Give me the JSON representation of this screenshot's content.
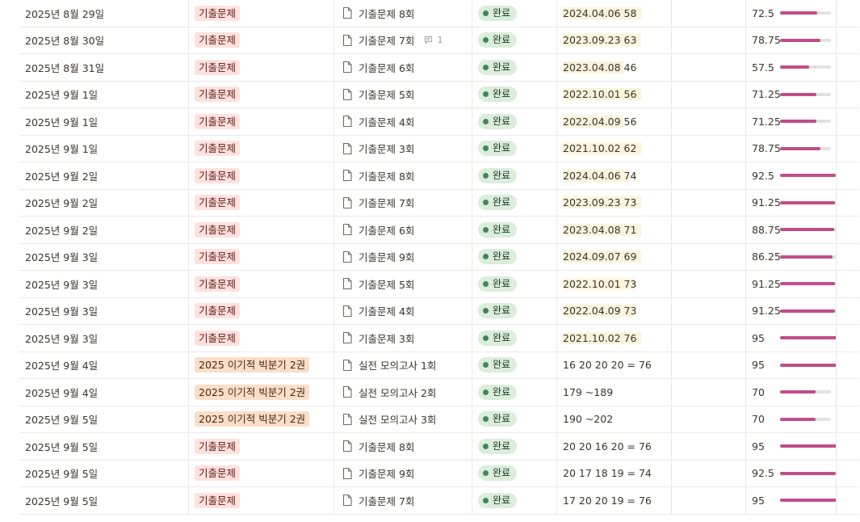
{
  "colors": {
    "tag_exam_bg": "#ffe2dd",
    "tag_exam_fg": "#5d1715",
    "tag_book_bg": "#fadec9",
    "tag_book_fg": "#49290e",
    "status_bg": "#dbeddb",
    "status_dot": "#448361",
    "highlight": "#fbf3db",
    "bar_fill": "#c14c8a",
    "bar_track": "#e3e2e0"
  },
  "rows": [
    {
      "date": "2025년 8월 29일",
      "tag": "기출문제",
      "tag_type": "exam",
      "name": "기출문제 8회",
      "comment_count": "",
      "status": "완료",
      "note": "2024.04.06 58",
      "highlight_chars": 13,
      "score": "72.5",
      "score_ratio": 0.725
    },
    {
      "date": "2025년 8월 30일",
      "tag": "기출문제",
      "tag_type": "exam",
      "name": "기출문제 7회",
      "comment_count": "1",
      "status": "완료",
      "note": "2023.09.23 63",
      "highlight_chars": 13,
      "score": "78.75",
      "score_ratio": 0.7875
    },
    {
      "date": "2025년 8월 31일",
      "tag": "기출문제",
      "tag_type": "exam",
      "name": "기출문제 6회",
      "comment_count": "",
      "status": "완료",
      "note": "2023.04.08 46",
      "highlight_chars": 10,
      "score": "57.5",
      "score_ratio": 0.575
    },
    {
      "date": "2025년 9월 1일",
      "tag": "기출문제",
      "tag_type": "exam",
      "name": "기출문제 5회",
      "comment_count": "",
      "status": "완료",
      "note": "2022.10.01 56",
      "highlight_chars": 13,
      "score": "71.25",
      "score_ratio": 0.7125
    },
    {
      "date": "2025년 9월 1일",
      "tag": "기출문제",
      "tag_type": "exam",
      "name": "기출문제 4회",
      "comment_count": "",
      "status": "완료",
      "note": "2022.04.09 56",
      "highlight_chars": 10,
      "score": "71.25",
      "score_ratio": 0.7125
    },
    {
      "date": "2025년 9월 1일",
      "tag": "기출문제",
      "tag_type": "exam",
      "name": "기출문제 3회",
      "comment_count": "",
      "status": "완료",
      "note": "2021.10.02 62",
      "highlight_chars": 13,
      "score": "78.75",
      "score_ratio": 0.7875
    },
    {
      "date": "2025년 9월 2일",
      "tag": "기출문제",
      "tag_type": "exam",
      "name": "기출문제 8회",
      "comment_count": "",
      "status": "완료",
      "note": "2024.04.06 74",
      "highlight_chars": 11,
      "score": "92.5",
      "score_ratio": 0.925
    },
    {
      "date": "2025년 9월 2일",
      "tag": "기출문제",
      "tag_type": "exam",
      "name": "기출문제 7회",
      "comment_count": "",
      "status": "완료",
      "note": "2023.09.23 73",
      "highlight_chars": 13,
      "score": "91.25",
      "score_ratio": 0.9125
    },
    {
      "date": "2025년 9월 2일",
      "tag": "기출문제",
      "tag_type": "exam",
      "name": "기출문제 6회",
      "comment_count": "",
      "status": "완료",
      "note": "2023.04.08 71",
      "highlight_chars": 13,
      "score": "88.75",
      "score_ratio": 0.8875
    },
    {
      "date": "2025년 9월 3일",
      "tag": "기출문제",
      "tag_type": "exam",
      "name": "기출문제 9회",
      "comment_count": "",
      "status": "완료",
      "note": "2024.09.07 69",
      "highlight_chars": 13,
      "score": "86.25",
      "score_ratio": 0.8625
    },
    {
      "date": "2025년 9월 3일",
      "tag": "기출문제",
      "tag_type": "exam",
      "name": "기출문제 5회",
      "comment_count": "",
      "status": "완료",
      "note": "2022.10.01 73",
      "highlight_chars": 12,
      "score": "91.25",
      "score_ratio": 0.9125
    },
    {
      "date": "2025년 9월 3일",
      "tag": "기출문제",
      "tag_type": "exam",
      "name": "기출문제 4회",
      "comment_count": "",
      "status": "완료",
      "note": "2022.04.09 73",
      "highlight_chars": 12,
      "score": "91.25",
      "score_ratio": 0.9125
    },
    {
      "date": "2025년 9월 3일",
      "tag": "기출문제",
      "tag_type": "exam",
      "name": "기출문제 3회",
      "comment_count": "",
      "status": "완료",
      "note": "2021.10.02 76",
      "highlight_chars": 13,
      "score": "95",
      "score_ratio": 0.95
    },
    {
      "date": "2025년 9월 4일",
      "tag": "2025 이기적 빅분기 2권",
      "tag_type": "book",
      "name": "실전 모의고사 1회",
      "comment_count": "",
      "status": "완료",
      "note": "16 20 20 20 = 76",
      "highlight_chars": 0,
      "score": "95",
      "score_ratio": 0.95
    },
    {
      "date": "2025년 9월 4일",
      "tag": "2025 이기적 빅분기 2권",
      "tag_type": "book",
      "name": "실전 모의고사 2회",
      "comment_count": "",
      "status": "완료",
      "note": "179 ~189",
      "highlight_chars": 0,
      "score": "70",
      "score_ratio": 0.7
    },
    {
      "date": "2025년 9월 5일",
      "tag": "2025 이기적 빅분기 2권",
      "tag_type": "book",
      "name": "실전 모의고사 3회",
      "comment_count": "",
      "status": "완료",
      "note": "190 ~202",
      "highlight_chars": 0,
      "score": "70",
      "score_ratio": 0.7
    },
    {
      "date": "2025년 9월 5일",
      "tag": "기출문제",
      "tag_type": "exam",
      "name": "기출문제 8회",
      "comment_count": "",
      "status": "완료",
      "note": "20 20 16 20 = 76",
      "highlight_chars": 0,
      "score": "95",
      "score_ratio": 0.95
    },
    {
      "date": "2025년 9월 5일",
      "tag": "기출문제",
      "tag_type": "exam",
      "name": "기출문제 9회",
      "comment_count": "",
      "status": "완료",
      "note": "20 17 18 19 = 74",
      "highlight_chars": 0,
      "score": "92.5",
      "score_ratio": 0.925
    },
    {
      "date": "2025년 9월 5일",
      "tag": "기출문제",
      "tag_type": "exam",
      "name": "기출문제 7회",
      "comment_count": "",
      "status": "완료",
      "note": "17 20 20 19 = 76",
      "highlight_chars": 0,
      "score": "95",
      "score_ratio": 0.95
    }
  ]
}
